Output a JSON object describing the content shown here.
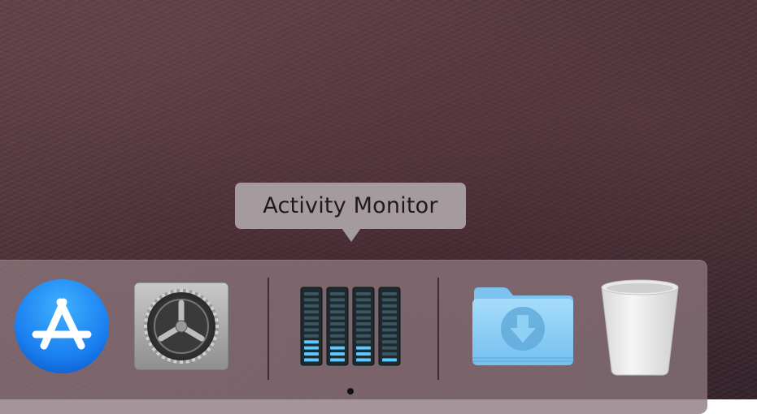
{
  "tooltip": {
    "label": "Activity Monitor"
  },
  "dock": {
    "items": [
      {
        "name": "App Store",
        "icon": "app-store-icon"
      },
      {
        "name": "System Preferences",
        "icon": "gear-icon"
      },
      {
        "name": "Activity Monitor",
        "icon": "activity-monitor-icon",
        "running": true
      },
      {
        "name": "Downloads",
        "icon": "downloads-folder-icon"
      },
      {
        "name": "Trash",
        "icon": "trash-icon"
      }
    ]
  },
  "colors": {
    "app_store_blue": "#1a8cf5",
    "meter_cyan": "#5ec8ff",
    "folder_blue": "#8ccff6"
  }
}
